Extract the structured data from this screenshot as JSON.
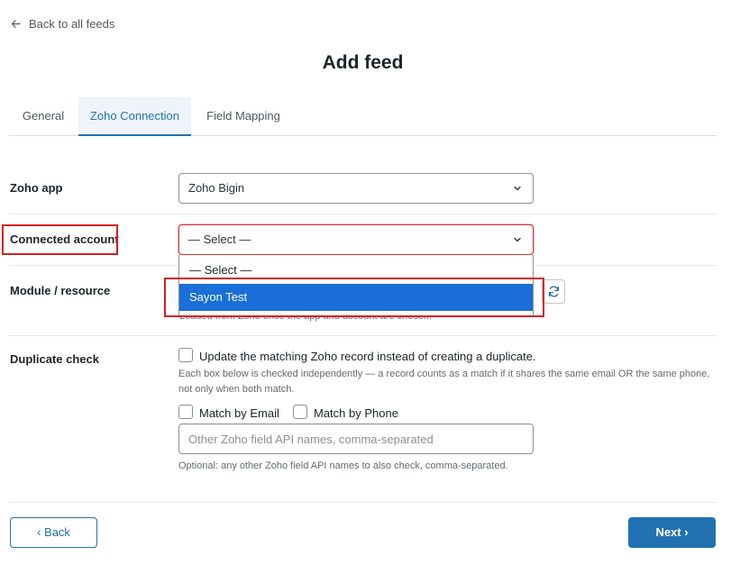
{
  "header": {
    "back_link": "Back to all feeds",
    "title": "Add feed"
  },
  "tabs": [
    {
      "label": "General",
      "active": false
    },
    {
      "label": "Zoho Connection",
      "active": true
    },
    {
      "label": "Field Mapping",
      "active": false
    }
  ],
  "form": {
    "zoho_app": {
      "label": "Zoho app",
      "value": "Zoho Bigin"
    },
    "connected_account": {
      "label": "Connected account",
      "value": "— Select —",
      "options": [
        "— Select —",
        "Sayon Test"
      ],
      "highlighted_option": "Sayon Test"
    },
    "module": {
      "label": "Module / resource",
      "hint": "Loaded from Zoho once the app and account are chosen."
    },
    "duplicate_check": {
      "label": "Duplicate check",
      "update_label": "Update the matching Zoho record instead of creating a duplicate.",
      "help_line1": "Each box below is checked independently — a record counts as a match if it shares the same email OR the same phone,",
      "help_line2": "not only when both match.",
      "match_email_label": "Match by Email",
      "match_phone_label": "Match by Phone",
      "other_fields_placeholder": "Other Zoho field API names, comma-separated",
      "other_fields_help": "Optional: any other Zoho field API names to also check, comma-separated."
    }
  },
  "footer": {
    "back_label": "‹ Back",
    "next_label": "Next ›"
  },
  "colors": {
    "accent": "#2271b1",
    "highlight": "#1a6fd8",
    "annotation": "#d81e1e"
  }
}
